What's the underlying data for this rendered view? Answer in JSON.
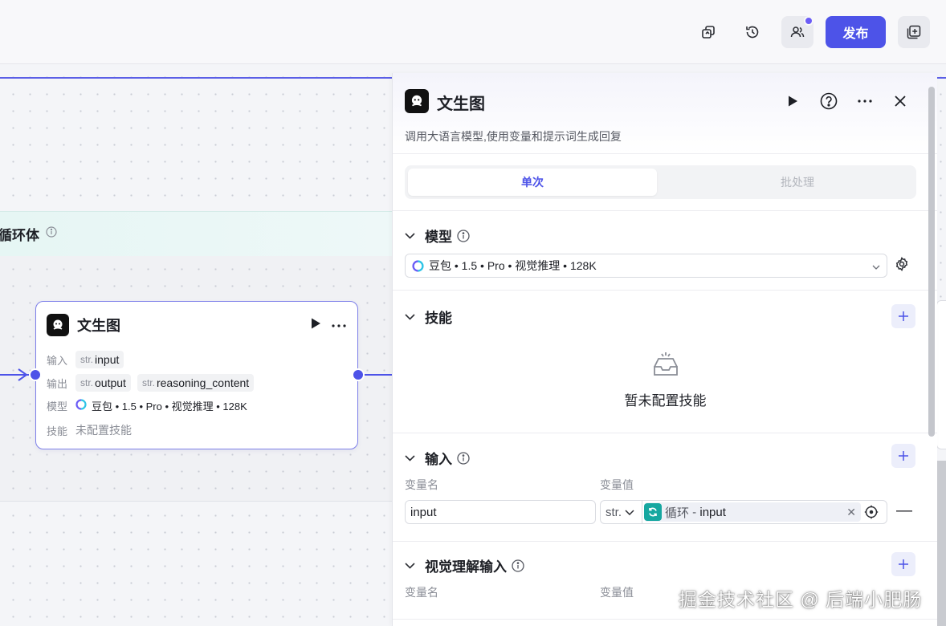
{
  "toolbar": {
    "publish_label": "发布",
    "icons": [
      "copy-icon",
      "history-icon",
      "collaborators-icon",
      "add-panel-icon"
    ]
  },
  "loop": {
    "title": "循环体"
  },
  "node": {
    "title": "文生图",
    "input_label": "输入",
    "input_type": "str.",
    "input_var": "input",
    "output_label": "输出",
    "output_type_1": "str.",
    "output_var_1": "output",
    "output_type_2": "str.",
    "output_var_2": "reasoning_content",
    "model_label": "模型",
    "model_value": "豆包 • 1.5 • Pro • 视觉推理 • 128K",
    "skill_label": "技能",
    "skill_value": "未配置技能"
  },
  "panel": {
    "title": "文生图",
    "description": "调用大语言模型,使用变量和提示词生成回复",
    "tabs": {
      "single": "单次",
      "batch": "批处理",
      "active": "single"
    },
    "model_section": "模型",
    "model_select": "豆包 • 1.5 • Pro • 视觉推理 • 128K",
    "skill_section": "技能",
    "skill_empty": "暂未配置技能",
    "input_section": "输入",
    "col_var_name": "变量名",
    "col_var_value": "变量值",
    "input_row": {
      "name": "input",
      "type": "str.",
      "ref_source": "循环",
      "ref_sep": " - ",
      "ref_var": "input"
    },
    "vision_section": "视觉理解输入",
    "vision_col_name": "变量名",
    "vision_col_value": "变量值"
  },
  "colors": {
    "accent": "#4d53e8",
    "loop_teal": "#16a7a0"
  },
  "watermark": "掘金技术社区 @ 后端小肥肠"
}
